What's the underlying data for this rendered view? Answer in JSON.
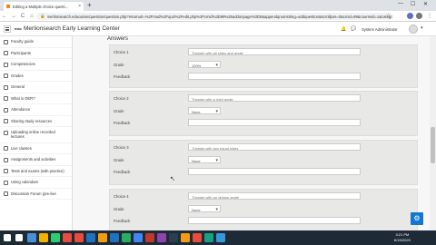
{
  "browser": {
    "tab_title": "Editing a Multiple choice questi...",
    "new_tab": "+",
    "url": "merlionsearch.education/question/question.php?returnurl=%2Fmod%2Fquiz%2Fedit.php%3Fcmid%3D99%26addonpage%3D0&appendqnumstring=addquestion&scrollpos=0&cmid=99&courseid=1&category=1&qtype=multichoice",
    "back": "←",
    "forward": "→",
    "reload": "C",
    "home": "⌂",
    "lock": "🔒",
    "star": "☆",
    "menu": "⋮",
    "minimize": "—",
    "maximize": "☐",
    "close": "✕"
  },
  "navbar": {
    "logo": "mac",
    "site_name": "Merlionsearch Early Learning Center",
    "user_name": "System Administrator",
    "bell": "🔔",
    "chat": "💬",
    "caret": "▾"
  },
  "drawer": {
    "items": [
      {
        "label": "Faculty guide"
      },
      {
        "label": "Participants"
      },
      {
        "label": "Competencies"
      },
      {
        "label": "Grades"
      },
      {
        "label": "General"
      },
      {
        "label": "What is OER?"
      },
      {
        "label": "Attendance"
      },
      {
        "label": "Sharing study resources"
      },
      {
        "label": "Uploading online recorded lectures"
      },
      {
        "label": "Live classes"
      },
      {
        "label": "Assignments and activities"
      },
      {
        "label": "Tests and exams (with practice)"
      },
      {
        "label": "Using calendars"
      },
      {
        "label": "Discussion Forum (pre-live"
      }
    ]
  },
  "main": {
    "heading": "Answers",
    "choices": [
      {
        "label": "Choice 1",
        "placeholder": "Triangle with all sides and angle",
        "grade_label": "Grade",
        "grade": "100%",
        "feedback_label": "Feedback"
      },
      {
        "label": "Choice 2",
        "placeholder": "Triangle with a right angle",
        "grade_label": "Grade",
        "grade": "None",
        "feedback_label": "Feedback"
      },
      {
        "label": "Choice 3",
        "placeholder": "Triangle with two equal sides",
        "grade_label": "Grade",
        "grade": "None",
        "feedback_label": "Feedback"
      },
      {
        "label": "Choice 4",
        "placeholder": "Triangle with an obtuse angle",
        "grade_label": "Grade",
        "grade": "None",
        "feedback_label": "Feedback"
      }
    ]
  },
  "fab": "⚙",
  "taskbar": {
    "time": "3:21 PM",
    "date": "6/19/2020",
    "colors": [
      "#ffffff",
      "#ffffff",
      "#4a90d9",
      "#f0b400",
      "#2ecc71",
      "#e74c3c",
      "#e74c3c",
      "#1e73be",
      "#f39c12",
      "#1e73be",
      "#27ae60",
      "#4285f4",
      "#c0392b",
      "#8e44ad",
      "#2c3e50",
      "#f39c12",
      "#e74c3c",
      "#16a085",
      "#3498db"
    ]
  }
}
